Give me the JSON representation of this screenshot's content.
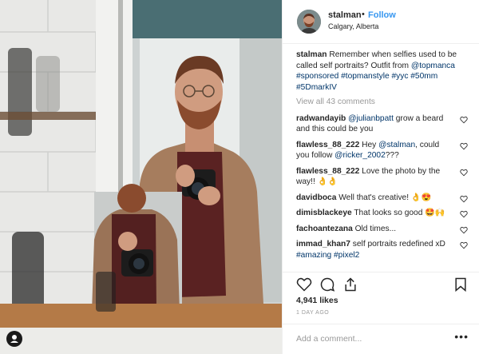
{
  "post": {
    "username": "stalman",
    "separator": "•",
    "follow_label": "Follow",
    "location": "Calgary, Alberta",
    "caption": {
      "user": "stalman",
      "text": "Remember when selfies used to be called self portraits?",
      "outfit_prefix": "Outfit from",
      "outfit_mention": "@topmanca",
      "hashtags": "#sponsored #topmanstyle #yyc #50mm #5DmarkIV"
    },
    "view_all": "View all 43 comments",
    "comments": [
      {
        "user": "radwandayib",
        "mention": "@julianbpatt",
        "text": "grow a beard and this could be you"
      },
      {
        "user": "flawless_88_222",
        "pre": "Hey",
        "mention": "@stalman",
        "text": ", could you follow",
        "mention2": "@ricker_2002",
        "text2": "???"
      },
      {
        "user": "flawless_88_222",
        "text": "Love the photo by the way!! 👌👌"
      },
      {
        "user": "davidboca",
        "text": "Well that's creative! 👌😍"
      },
      {
        "user": "dimisblackeye",
        "text": "That looks so good 🤩🙌"
      },
      {
        "user": "fachoantezana",
        "text": "Old times..."
      },
      {
        "user": "immad_khan7",
        "text": "self portraits redefined xD",
        "tags": "#amazing #pixel2"
      }
    ],
    "likes": "4,941 likes",
    "time_ago": "1 DAY AGO",
    "add_comment_placeholder": "Add a comment...",
    "more_label": "•••"
  },
  "icons": {
    "like": "heart-icon",
    "comment": "comment-bubble-icon",
    "share": "share-icon",
    "save": "bookmark-icon",
    "comment_like": "heart-outline-icon",
    "profile_badge": "user-icon"
  },
  "colors": {
    "link": "#3897f0",
    "hashtag": "#003569",
    "muted": "#999999",
    "text": "#262626"
  }
}
